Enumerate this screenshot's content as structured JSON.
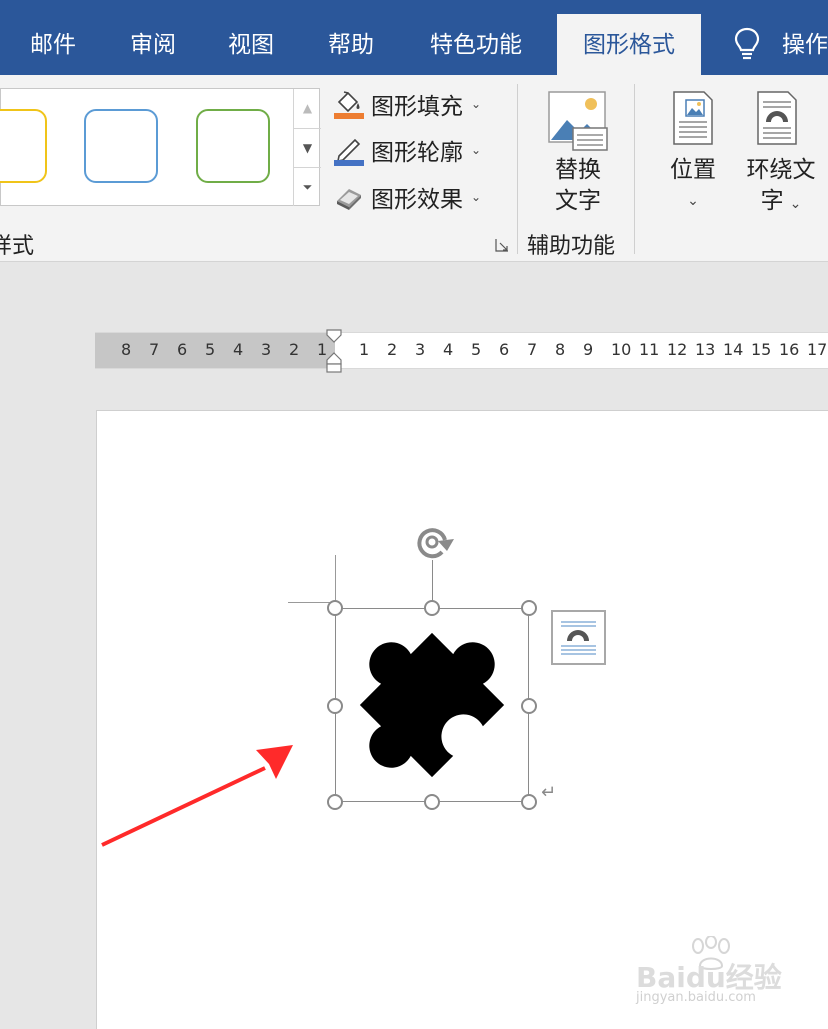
{
  "tabs": [
    {
      "label": "邮件"
    },
    {
      "label": "审阅"
    },
    {
      "label": "视图"
    },
    {
      "label": "帮助"
    },
    {
      "label": "特色功能"
    },
    {
      "label": "图形格式"
    },
    {
      "label": "操作"
    }
  ],
  "ribbon": {
    "styles_group_label": "样式",
    "shape_fill": "图形填充",
    "shape_outline": "图形轮廓",
    "shape_effects": "图形效果",
    "alt_text_line1": "替换",
    "alt_text_line2": "文字",
    "accessibility_group_label": "辅助功能",
    "position_label": "位置",
    "wrap_text_line1": "环绕文",
    "wrap_text_line2": "字",
    "gallery_colors": [
      "#f0c419",
      "#5b9bd5",
      "#70ad47"
    ]
  },
  "ruler": {
    "left_ticks": [
      "8",
      "7",
      "6",
      "5",
      "4",
      "3",
      "2",
      "1"
    ],
    "right_ticks": [
      "1",
      "2",
      "3",
      "4",
      "5",
      "6",
      "7",
      "8",
      "9",
      "10",
      "11",
      "12",
      "13",
      "14",
      "15",
      "16",
      "17"
    ]
  },
  "watermark": {
    "brand": "Baidu经验",
    "url": "jingyan.baidu.com"
  },
  "colors": {
    "ribbon_blue": "#2b579a",
    "arrow_red": "#ff2a2a"
  }
}
